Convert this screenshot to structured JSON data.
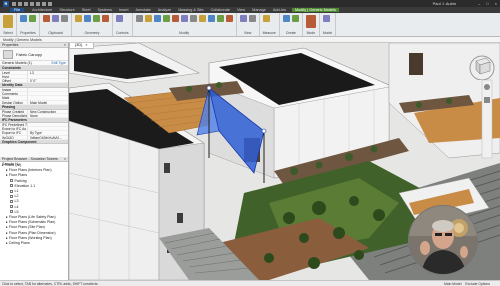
{
  "titlebar": {
    "app_logo": "R",
    "user": "Paul J. Aubin"
  },
  "ribbon_tabs": [
    {
      "label": "File",
      "kind": "file"
    },
    {
      "label": "Architecture",
      "kind": "normal"
    },
    {
      "label": "Structure",
      "kind": "normal"
    },
    {
      "label": "Steel",
      "kind": "normal"
    },
    {
      "label": "Systems",
      "kind": "normal"
    },
    {
      "label": "Insert",
      "kind": "normal"
    },
    {
      "label": "Annotate",
      "kind": "normal"
    },
    {
      "label": "Analyze",
      "kind": "normal"
    },
    {
      "label": "Massing & Site",
      "kind": "normal"
    },
    {
      "label": "Collaborate",
      "kind": "normal"
    },
    {
      "label": "View",
      "kind": "normal"
    },
    {
      "label": "Manage",
      "kind": "normal"
    },
    {
      "label": "Add-Ins",
      "kind": "normal"
    },
    {
      "label": "Modify | Generic Models",
      "kind": "ctx"
    }
  ],
  "ribbon_groups": [
    {
      "label": "Select",
      "icons": [
        "modify-icon"
      ],
      "big": true
    },
    {
      "label": "Properties",
      "icons": [
        "properties-icon",
        "type-properties-icon"
      ],
      "big": false
    },
    {
      "label": "Clipboard",
      "icons": [
        "paste-icon",
        "cut-icon",
        "copy-icon"
      ],
      "big": false
    },
    {
      "label": "Geometry",
      "icons": [
        "join-icon",
        "cut-geometry-icon",
        "wall-joins-icon",
        "paint-icon"
      ],
      "big": false
    },
    {
      "label": "Controls",
      "icons": [
        "flip-icon"
      ],
      "big": false
    },
    {
      "label": "Modify",
      "icons": [
        "align-icon",
        "offset-icon",
        "mirror-icon",
        "move-icon",
        "copy-icon",
        "rotate-icon",
        "trim-icon",
        "array-icon",
        "scale-icon",
        "pin-icon",
        "delete-icon"
      ],
      "big": false
    },
    {
      "label": "View",
      "icons": [
        "hide-icon",
        "override-icon"
      ],
      "big": false
    },
    {
      "label": "Measure",
      "icons": [
        "measure-icon"
      ],
      "big": false
    },
    {
      "label": "Create",
      "icons": [
        "create-group-icon",
        "create-parts-icon"
      ],
      "big": false
    },
    {
      "label": "Mode",
      "icons": [
        "edit-family-icon"
      ],
      "big": true
    },
    {
      "label": "Model",
      "icons": [
        "model-icon"
      ],
      "big": false
    }
  ],
  "ribbon_icon_colors": [
    "#c9a13b",
    "#4f86c6",
    "#6c9e45",
    "#b85c38",
    "#7f7fbf",
    "#888888"
  ],
  "options_bar": {
    "text": "Modify | Generic Models"
  },
  "properties": {
    "header": "Properties",
    "type_name": "Fabric Canopy",
    "selector": "Generic Models (1)",
    "edit_type": "Edit Type",
    "categories": [
      {
        "name": "Constraints",
        "rows": [
          {
            "k": "Level",
            "v": "L3"
          },
          {
            "k": "Host",
            "v": ""
          },
          {
            "k": "Offset",
            "v": "0' 0\""
          }
        ]
      },
      {
        "name": "Identity Data",
        "rows": [
          {
            "k": "Image",
            "v": ""
          },
          {
            "k": "Comments",
            "v": ""
          },
          {
            "k": "Mark",
            "v": ""
          },
          {
            "k": "Design Option",
            "v": "Main Model"
          }
        ]
      },
      {
        "name": "Phasing",
        "rows": [
          {
            "k": "Phase Created",
            "v": "New Construction"
          },
          {
            "k": "Phase Demolished",
            "v": "None"
          }
        ]
      },
      {
        "name": "IFC Parameters",
        "rows": [
          {
            "k": "IFC Predefined Type",
            "v": ""
          },
          {
            "k": "Export to IFC As",
            "v": ""
          },
          {
            "k": "Export to IFC",
            "v": "By Type"
          },
          {
            "k": "IfcGUID",
            "v": "0dfgmQLBtnYuAVtJ..."
          }
        ]
      },
      {
        "name": "Graphics Component",
        "rows": []
      }
    ]
  },
  "browser": {
    "header": "Project Browser - Snowdon Towers Sample H...",
    "items": [
      {
        "label": "Views (all)",
        "indent": 0,
        "cb": false
      },
      {
        "label": "Floor Plans (Interiors Plan)",
        "indent": 1,
        "cb": false
      },
      {
        "label": "Floor Plans",
        "indent": 1,
        "cb": false
      },
      {
        "label": "Parking",
        "indent": 2,
        "cb": true
      },
      {
        "label": "Elevation 1.1",
        "indent": 2,
        "cb": true
      },
      {
        "label": "L1",
        "indent": 2,
        "cb": true
      },
      {
        "label": "L2",
        "indent": 2,
        "cb": true
      },
      {
        "label": "L3",
        "indent": 2,
        "cb": true
      },
      {
        "label": "L4",
        "indent": 2,
        "cb": true
      },
      {
        "label": "L5",
        "indent": 2,
        "cb": true
      },
      {
        "label": "Floor Plans (Life Safety Plan)",
        "indent": 1,
        "cb": false
      },
      {
        "label": "Floor Plans (Schematic Plan)",
        "indent": 1,
        "cb": false
      },
      {
        "label": "Floor Plans (Site Plan)",
        "indent": 1,
        "cb": false
      },
      {
        "label": "Floor Plans (Plan Dimension)",
        "indent": 1,
        "cb": false
      },
      {
        "label": "Floor Plans (Working Plan)",
        "indent": 1,
        "cb": false
      },
      {
        "label": "Ceiling Plans",
        "indent": 1,
        "cb": false
      }
    ]
  },
  "view": {
    "tab_label": "{3D}",
    "tab_close": "×",
    "navcube": {
      "top": "TOP",
      "front": "FRONT"
    }
  },
  "status": {
    "left": "Click to select, TAB for alternates, CTRL adds, SHIFT unselects.",
    "model": "Main Model",
    "options": "Exclude Options"
  },
  "colors": {
    "canopy": "#2f5fd6",
    "wood_deck": "#c98c46",
    "roof_dark": "#1c1c1c",
    "wall_white": "#f4f4f4",
    "planting": "#41612a",
    "pavement": "#8c8f8c",
    "ribbon_ctx_tab": "#4d8c2e"
  }
}
